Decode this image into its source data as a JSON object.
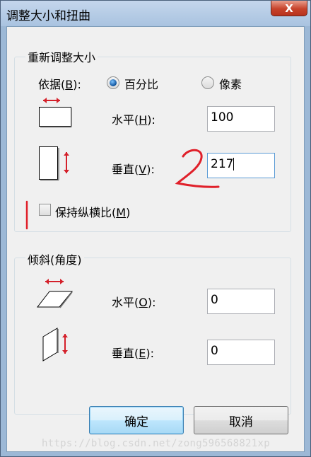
{
  "window": {
    "title": "调整大小和扭曲",
    "close_label": "X"
  },
  "resize": {
    "group_title": "重新调整大小",
    "by_label_prefix": "依据(",
    "by_label_key": "B",
    "by_label_suffix": "):",
    "options": [
      {
        "label": "百分比",
        "selected": true
      },
      {
        "label": "像素",
        "selected": false
      }
    ],
    "horizontal": {
      "label_prefix": "水平(",
      "key": "H",
      "label_suffix": "):",
      "value": "100"
    },
    "vertical": {
      "label_prefix": "垂直(",
      "key": "V",
      "label_suffix": "):",
      "value": "217"
    },
    "keep_ratio": {
      "label_prefix": "保持纵横比(",
      "key": "M",
      "label_suffix": ")",
      "checked": false
    }
  },
  "skew": {
    "group_title": "倾斜(角度)",
    "horizontal": {
      "label_prefix": "水平(",
      "key": "O",
      "label_suffix": "):",
      "value": "0"
    },
    "vertical": {
      "label_prefix": "垂直(",
      "key": "E",
      "label_suffix": "):",
      "value": "0"
    }
  },
  "buttons": {
    "ok": "确定",
    "cancel": "取消"
  },
  "watermark": "https://blog.csdn.net/zong596568821xp",
  "annotation": {
    "number": "2",
    "color": "#e0202a"
  },
  "colors": {
    "accent": "#3c7fb1",
    "annotation": "#e0202a",
    "icon_arrow": "#d4202a"
  }
}
